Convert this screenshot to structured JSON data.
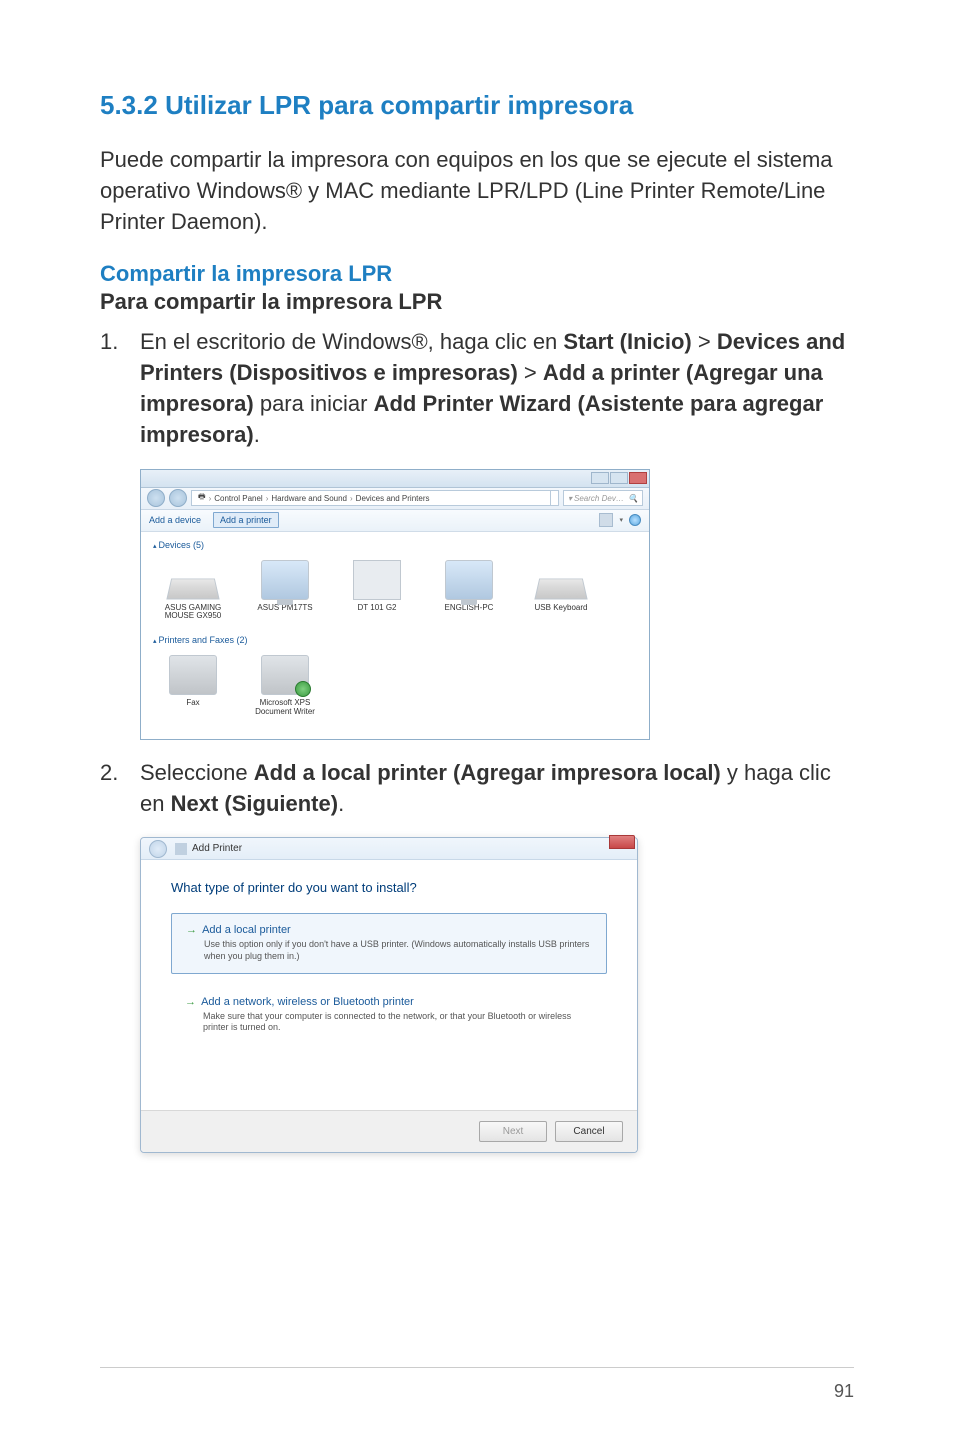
{
  "section": {
    "number": "5.3.2",
    "title": "Utilizar LPR para compartir impresora"
  },
  "intro": "Puede compartir la impresora con equipos en los que se ejecute el sistema operativo Windows® y MAC mediante LPR/LPD (Line Printer Remote/Line Printer Daemon).",
  "subheading": "Compartir la impresora LPR",
  "boldline": "Para compartir la impresora LPR",
  "step1": {
    "num": "1.",
    "prefix": "En el escritorio de Windows®, haga clic en ",
    "s1": "Start (Inicio)",
    "gt1": " > ",
    "s2": "Devices and Printers (Dispositivos e impresoras)",
    "gt2": " > ",
    "s3": "Add a printer (Agregar una impresora)",
    "mid": " para iniciar ",
    "s4": "Add Printer Wizard (Asistente para agregar impresora)",
    "end": "."
  },
  "step2": {
    "num": "2.",
    "prefix": "Seleccione ",
    "s1": "Add a local printer (Agregar impresora local)",
    "mid": " y haga clic en ",
    "s2": "Next (Siguiente)",
    "end": "."
  },
  "win1": {
    "crumb1": "Control Panel",
    "crumb2": "Hardware and Sound",
    "crumb3": "Devices and Printers",
    "search": "Search Dev…",
    "tb1": "Add a device",
    "tb2": "Add a printer",
    "group1": "Devices (5)",
    "group2": "Printers and Faxes (2)",
    "d1": "ASUS GAMING MOUSE GX950",
    "d2": "ASUS PM17TS",
    "d3": "DT 101 G2",
    "d4": "ENGLISH-PC",
    "d5": "USB Keyboard",
    "p1": "Fax",
    "p2": "Microsoft XPS Document Writer"
  },
  "win2": {
    "title": "Add Printer",
    "heading": "What type of printer do you want to install?",
    "opt1_title": "Add a local printer",
    "opt1_desc": "Use this option only if you don't have a USB printer. (Windows automatically installs USB printers when you plug them in.)",
    "opt2_title": "Add a network, wireless or Bluetooth printer",
    "opt2_desc": "Make sure that your computer is connected to the network, or that your Bluetooth or wireless printer is turned on.",
    "next": "Next",
    "cancel": "Cancel"
  },
  "page_number": "91"
}
